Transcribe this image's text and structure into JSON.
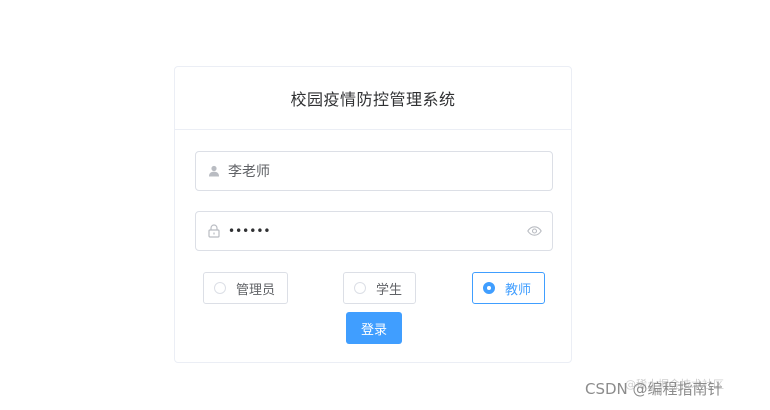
{
  "card": {
    "title": "校园疫情防控管理系统"
  },
  "username": {
    "value": "李老师",
    "icon": "user-icon"
  },
  "password": {
    "value": "••••••",
    "icon": "lock-icon",
    "toggle_icon": "eye-icon"
  },
  "roles": [
    {
      "label": "管理员",
      "checked": false
    },
    {
      "label": "学生",
      "checked": false
    },
    {
      "label": "教师",
      "checked": true
    }
  ],
  "login_button": {
    "label": "登录"
  },
  "watermark": {
    "text": "CSDN @编程指南针",
    "overlay_text": "@稀土掘金技术社区"
  },
  "colors": {
    "primary": "#409eff",
    "border": "#dcdfe6",
    "text": "#606266"
  }
}
